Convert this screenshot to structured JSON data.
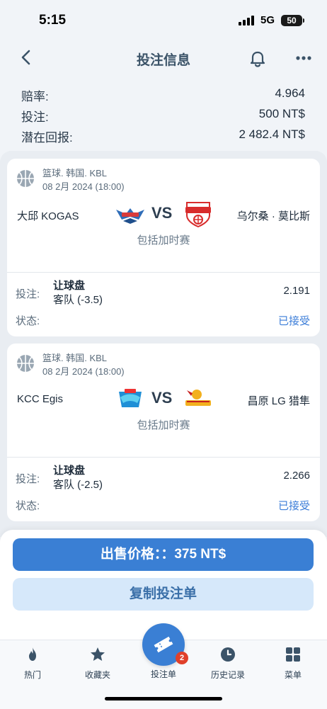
{
  "status_bar": {
    "time": "5:15",
    "network": "5G",
    "battery": "50"
  },
  "nav": {
    "title": "投注信息",
    "back_icon": "chevron-left-icon",
    "bell_icon": "bell-icon",
    "more_icon": "ellipsis-icon"
  },
  "summary": {
    "odds_label": "赔率:",
    "odds_value": "4.964",
    "stake_label": "投注:",
    "stake_value": "500 NT$",
    "return_label": "潜在回报:",
    "return_value": "2 482.4 NT$"
  },
  "bets": [
    {
      "league": "篮球. 韩国. KBL",
      "date": "08 2月 2024 (18:00)",
      "home": "大邱 KOGAS",
      "vs": "VS",
      "away": "乌尔桑 · 莫比斯",
      "overtime": "包括加时赛",
      "bet_label": "投注:",
      "market": "让球盘",
      "selection": "客队 (-3.5)",
      "odds": "2.191",
      "status_label": "状态:",
      "status": "已接受"
    },
    {
      "league": "篮球. 韩国. KBL",
      "date": "08 2月 2024 (18:00)",
      "home": "KCC Egis",
      "vs": "VS",
      "away": "昌原 LG 猎隼",
      "overtime": "包括加时赛",
      "bet_label": "投注:",
      "market": "让球盘",
      "selection": "客队 (-2.5)",
      "odds": "2.266",
      "status_label": "状态:",
      "status": "已接受"
    }
  ],
  "actions": {
    "sell": "出售价格：：375 NT$",
    "copy": "复制投注单"
  },
  "tabs": [
    {
      "label": "热门",
      "icon": "flame-icon"
    },
    {
      "label": "收藏夹",
      "icon": "star-icon"
    },
    {
      "label": "投注单",
      "icon": "ticket-icon",
      "badge": "2"
    },
    {
      "label": "历史记录",
      "icon": "clock-icon"
    },
    {
      "label": "菜单",
      "icon": "grid-icon"
    }
  ],
  "colors": {
    "accent": "#3a7fd4",
    "accepted": "#3b7dd8",
    "background": "#f1f4f8"
  }
}
